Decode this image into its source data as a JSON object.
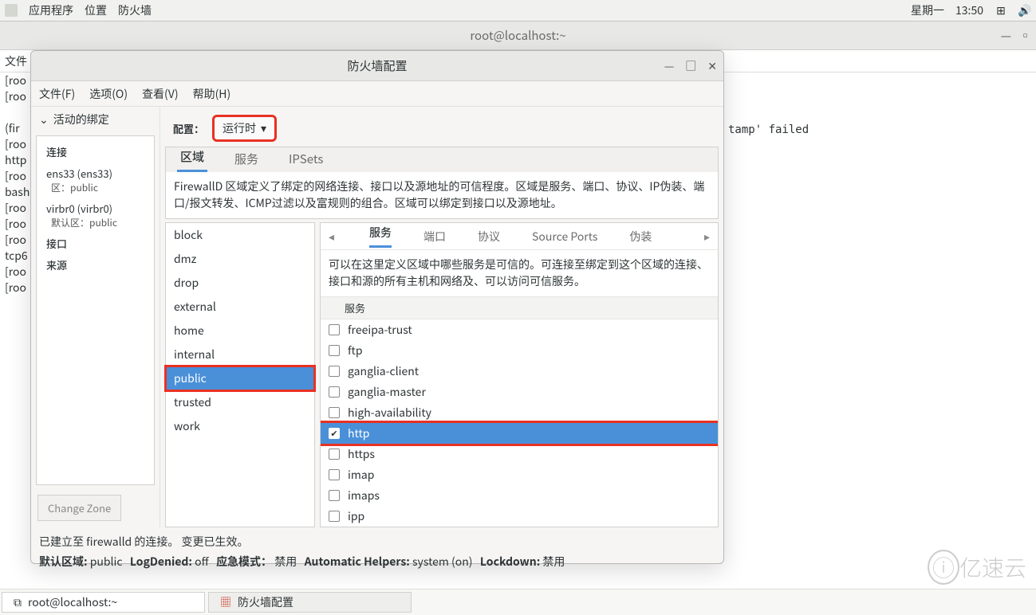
{
  "top_panel": {
    "menus": [
      "应用程序",
      "位置",
      "防火墙"
    ],
    "day": "星期一",
    "time": "13:50"
  },
  "terminal": {
    "title": "root@localhost:~",
    "menu_file": "文件",
    "bg_lines": "[roo\n[roo\n\n(fir\n[roo\nhttp\n[roo\nbash\n[roo\n[roo\n[roo\ntcp6\n[roo\n[roo",
    "bg_right": "tamp'  failed"
  },
  "fw": {
    "title": "防火墙配置",
    "menubar": [
      "文件(F)",
      "选项(O)",
      "查看(V)",
      "帮助(H)"
    ],
    "config_label": "配置：",
    "config_value": "运行时",
    "left": {
      "accordion": "活动的绑定",
      "conn_label": "连接",
      "iface1": "ens33 (ens33)",
      "iface1_sub": "区：public",
      "iface2": "virbr0 (virbr0)",
      "iface2_sub": "默认区：public",
      "jk": "接口",
      "ly": "来源",
      "change_zone": "Change Zone"
    },
    "tabs": {
      "zone": "区域",
      "service": "服务",
      "ipsets": "IPSets"
    },
    "zone_desc": "FirewallD 区域定义了绑定的网络连接、接口以及源地址的可信程度。区域是服务、端口、协议、IP伪装、端口/报文转发、ICMP过滤以及富规则的组合。区域可以绑定到接口以及源地址。",
    "zones": [
      "block",
      "dmz",
      "drop",
      "external",
      "home",
      "internal",
      "public",
      "trusted",
      "work"
    ],
    "zone_selected": "public",
    "subtabs": {
      "svc": "服务",
      "port": "端口",
      "proto": "协议",
      "src": "Source Ports",
      "masq": "伪装"
    },
    "svc_desc": "可以在这里定义区域中哪些服务是可信的。可连接至绑定到这个区域的连接、接口和源的所有主机和网络及、可以访问可信服务。",
    "svc_header": "服务",
    "services": [
      {
        "name": "freeipa-trust",
        "checked": false
      },
      {
        "name": "ftp",
        "checked": false
      },
      {
        "name": "ganglia-client",
        "checked": false
      },
      {
        "name": "ganglia-master",
        "checked": false
      },
      {
        "name": "high-availability",
        "checked": false
      },
      {
        "name": "http",
        "checked": true
      },
      {
        "name": "https",
        "checked": false
      },
      {
        "name": "imap",
        "checked": false
      },
      {
        "name": "imaps",
        "checked": false
      },
      {
        "name": "ipp",
        "checked": false
      }
    ],
    "svc_selected": "http",
    "status1": "已建立至 firewalld 的连接。 变更已生效。",
    "status2_defzone_l": "默认区域:",
    "status2_defzone_v": "public",
    "status2_logd_l": "LogDenied:",
    "status2_logd_v": "off",
    "status2_panic_l": "应急模式：",
    "status2_panic_v": "禁用",
    "status2_auto_l": "Automatic Helpers:",
    "status2_auto_v": "system (on)",
    "status2_lock_l": "Lockdown:",
    "status2_lock_v": "禁用"
  },
  "taskbar": {
    "task1": "root@localhost:~",
    "task2": "防火墙配置"
  },
  "watermark": "亿速云"
}
